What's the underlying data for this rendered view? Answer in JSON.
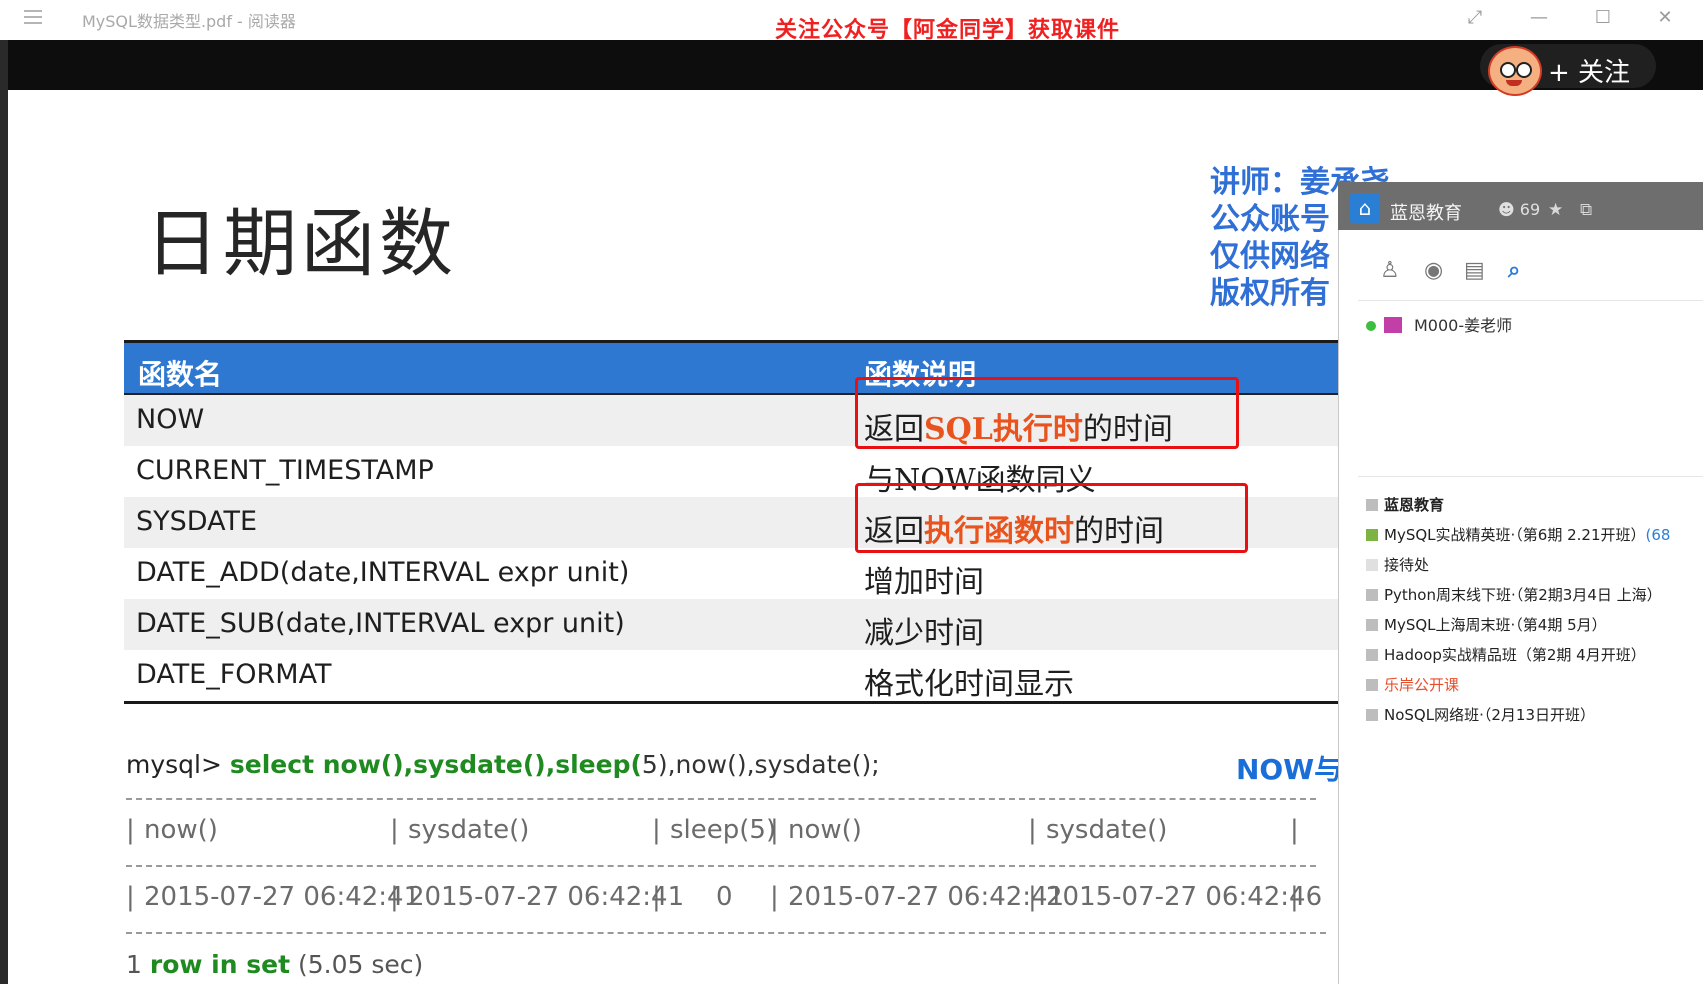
{
  "window": {
    "doc_title": "MySQL数据类型.pdf - 阅读器",
    "promo_banner": "关注公众号【阿金同学】获取课件",
    "btn_fullscreen": "⤢",
    "btn_minimize": "—",
    "btn_maximize": "☐",
    "btn_close": "✕"
  },
  "follow": {
    "label": "+ 关注"
  },
  "slide": {
    "title": "日期函数",
    "lecturer_lines": [
      "讲师：姜承尧",
      "公众账号",
      "仅供网络",
      "版权所有"
    ],
    "table": {
      "headers": [
        "函数名",
        "函数说明"
      ],
      "rows": [
        {
          "name": "NOW",
          "desc_pre": "返回",
          "desc_hl": "SQL执行时",
          "desc_post": "的时间"
        },
        {
          "name": "CURRENT_TIMESTAMP",
          "desc": "与NOW函数同义"
        },
        {
          "name": "SYSDATE",
          "desc_pre": "返回",
          "desc_hl": "执行函数时",
          "desc_post": "的时间"
        },
        {
          "name": "DATE_ADD(date,INTERVAL expr unit)",
          "desc": "增加时间"
        },
        {
          "name": "DATE_SUB(date,INTERVAL expr unit)",
          "desc": "减少时间"
        },
        {
          "name": "DATE_FORMAT",
          "desc": "格式化时间显示"
        }
      ]
    },
    "sql": {
      "prompt": "mysql>",
      "kw1": "select now(),sysdate(),sleep(",
      "num": "5",
      "rest": "),now(),sysdate();"
    },
    "now_label": "NOW与",
    "output": {
      "headers": [
        "now()",
        "sysdate()",
        "sleep(5)",
        "now()",
        "sysdate()"
      ],
      "values": [
        "2015-07-27 06:42:41",
        "2015-07-27 06:42:41",
        "0",
        "2015-07-27 06:42:41",
        "2015-07-27 06:42:46"
      ],
      "rows_info_num": "1",
      "rows_info_text": "row in set",
      "rows_info_time": "(5.05 sec)"
    }
  },
  "qq_panel": {
    "group_name": "蓝恩教育",
    "member_count": "69",
    "member": "M000-姜老师",
    "channels": [
      {
        "label": "蓝恩教育",
        "style": "title"
      },
      {
        "label": "MySQL实战精英班·（第6期 2.21开班）",
        "suffix": "(68"
      },
      {
        "label": "接待处"
      },
      {
        "label": "Python周末线下班·（第2期3月4日 上海）"
      },
      {
        "label": "MySQL上海周末班·（第4期 5月）"
      },
      {
        "label": "Hadoop实战精品班（第2期 4月开班）"
      },
      {
        "label": "乐岸公开课",
        "style": "orange"
      },
      {
        "label": "NoSQL网络班·（2月13日开班）"
      }
    ]
  }
}
